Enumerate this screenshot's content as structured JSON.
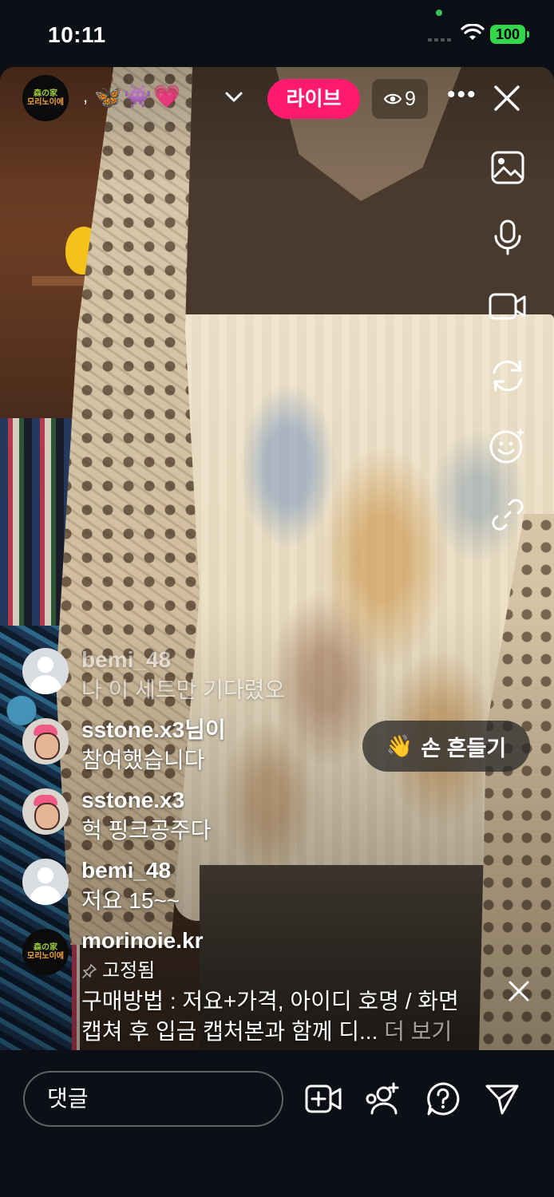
{
  "status_bar": {
    "time": "10:11",
    "battery": "100"
  },
  "header": {
    "emoji": "🦋👾💗",
    "live_label": "라이브",
    "viewer_count": "9"
  },
  "wave_button": {
    "emoji": "👋",
    "label": "손 흔들기"
  },
  "comments": [
    {
      "user": "bemi_48",
      "text": "나 이 세트만 기다렸오"
    },
    {
      "user": "sstone.x3님이",
      "text": "참여했습니다"
    },
    {
      "user": "sstone.x3",
      "text": "헉 핑크공주다"
    },
    {
      "user": "bemi_48",
      "text": "저요 15~~"
    }
  ],
  "pinned": {
    "user": "morinoie.kr",
    "tag": "고정됨",
    "text_line1": "구매방법 : 저요+가격, 아이디 호명 / 화면",
    "text_line2": "캡쳐 후 입금 캡처본과 함께 디...",
    "more": "더 보기"
  },
  "brand_avatar": {
    "line1": "森の家",
    "line2": "모리노이에"
  },
  "bottom": {
    "comment_placeholder": "댓글"
  }
}
